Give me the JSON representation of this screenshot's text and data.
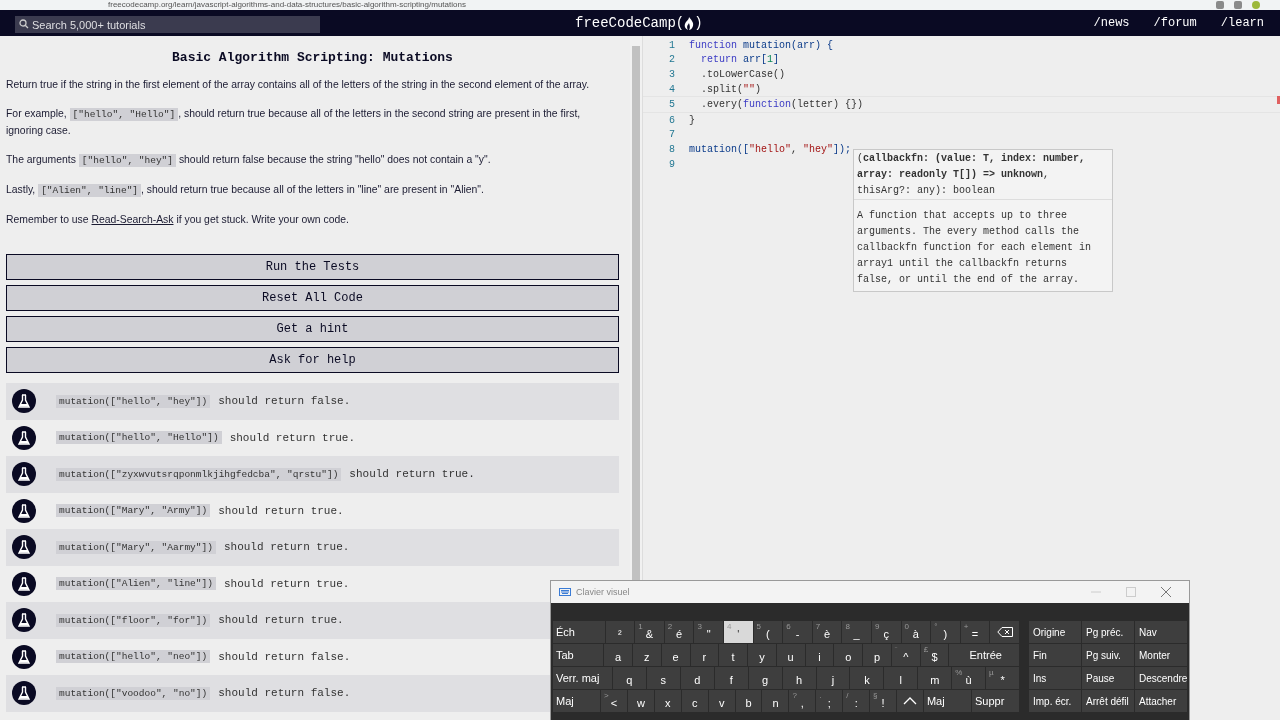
{
  "browser": {
    "url": "freecodecamp.org/learn/javascript-algorithms-and-data-structures/basic-algorithm-scripting/mutations"
  },
  "navbar": {
    "search": {
      "placeholder": "Search 5,000+ tutorials"
    },
    "logo": {
      "text": "freeCodeCamp",
      "open": "(",
      "close": ")"
    },
    "links": [
      "/news",
      "/forum",
      "/learn"
    ]
  },
  "challenge": {
    "title": "Basic Algorithm Scripting: Mutations",
    "paragraphs": [
      [
        {
          "kind": "text",
          "text": "Return true if the string in the first element of the array contains all of the letters of the string in the second element of the array."
        }
      ],
      [
        {
          "kind": "text",
          "text": "For example, "
        },
        {
          "kind": "code",
          "text": "[\"hello\", \"Hello\"]"
        },
        {
          "kind": "text",
          "text": ", should return true because all of the letters in the second string are present in the first, ignoring case."
        }
      ],
      [
        {
          "kind": "text",
          "text": "The arguments "
        },
        {
          "kind": "code",
          "text": "[\"hello\", \"hey\"]"
        },
        {
          "kind": "text",
          "text": " should return false because the string \"hello\" does not contain a \"y\"."
        }
      ],
      [
        {
          "kind": "text",
          "text": "Lastly, "
        },
        {
          "kind": "code",
          "text": "[\"Alien\", \"line\"]"
        },
        {
          "kind": "text",
          "text": ", should return true because all of the letters in \"line\" are present in \"Alien\"."
        }
      ],
      [
        {
          "kind": "text",
          "text": "Remember to use "
        },
        {
          "kind": "link",
          "text": "Read-Search-Ask"
        },
        {
          "kind": "text",
          "text": " if you get stuck. Write your own code."
        }
      ]
    ],
    "buttons": [
      "Run the Tests",
      "Reset All Code",
      "Get a hint",
      "Ask for help"
    ],
    "tests": [
      {
        "code": "mutation([\"hello\", \"hey\"])",
        "text": "should return false."
      },
      {
        "code": "mutation([\"hello\", \"Hello\"])",
        "text": "should return true."
      },
      {
        "code": "mutation([\"zyxwvutsrqponmlkjihgfedcba\", \"qrstu\"])",
        "text": "should return true."
      },
      {
        "code": "mutation([\"Mary\", \"Army\"])",
        "text": "should return true."
      },
      {
        "code": "mutation([\"Mary\", \"Aarmy\"])",
        "text": "should return true."
      },
      {
        "code": "mutation([\"Alien\", \"line\"])",
        "text": "should return true."
      },
      {
        "code": "mutation([\"floor\", \"for\"])",
        "text": "should return true."
      },
      {
        "code": "mutation([\"hello\", \"neo\"])",
        "text": "should return false."
      },
      {
        "code": "mutation([\"voodoo\", \"no\"])",
        "text": "should return false."
      }
    ]
  },
  "editor": {
    "lines": [
      {
        "number": "1",
        "indent": false,
        "tokens": [
          {
            "kind": "keyword",
            "text": "function"
          },
          {
            "kind": "name",
            "text": " mutation(arr) {"
          }
        ]
      },
      {
        "number": "2",
        "indent": true,
        "tokens": [
          {
            "kind": "keyword",
            "text": "return"
          },
          {
            "kind": "name",
            "text": " arr["
          },
          {
            "kind": "number",
            "text": "1"
          },
          {
            "kind": "name",
            "text": "]"
          }
        ]
      },
      {
        "number": "3",
        "indent": true,
        "tokens": [
          {
            "kind": "plain",
            "text": ".toLowerCase()"
          }
        ]
      },
      {
        "number": "4",
        "indent": true,
        "tokens": [
          {
            "kind": "plain",
            "text": ".split("
          },
          {
            "kind": "string",
            "text": "\"\""
          },
          {
            "kind": "plain",
            "text": ")"
          }
        ]
      },
      {
        "number": "5",
        "indent": true,
        "tokens": [
          {
            "kind": "plain",
            "text": ".every("
          },
          {
            "kind": "keyword",
            "text": "function"
          },
          {
            "kind": "plain",
            "text": "(letter) {})"
          }
        ]
      },
      {
        "number": "6",
        "indent": false,
        "tokens": [
          {
            "kind": "plain",
            "text": "}"
          }
        ]
      },
      {
        "number": "7"
      },
      {
        "number": "8",
        "indent": false,
        "tokens": [
          {
            "kind": "name",
            "text": "mutation(["
          },
          {
            "kind": "string",
            "text": "\"hello\""
          },
          {
            "kind": "plain",
            "text": ", "
          },
          {
            "kind": "string",
            "text": "\"hey\""
          },
          {
            "kind": "name",
            "text": "]);"
          }
        ]
      },
      {
        "number": "9"
      }
    ],
    "tooltip": {
      "signature": "(**callbackfn: (value: T, index: number, array: readonly T[]) => unknown**, thisArg?: any): boolean",
      "description": "A function that accepts up to three arguments. The every method calls the callbackfn function for each element in array1 until the callbackfn returns false, or until the end of the array."
    }
  },
  "keyboard": {
    "title": "Clavier visuel",
    "number_row": [
      {
        "label": "Éch",
        "pressed": false
      },
      {
        "label": "²",
        "pressed": false
      },
      {
        "alt": "1",
        "label": "&",
        "pressed": false
      },
      {
        "alt": "2",
        "label": "é",
        "pressed": false
      },
      {
        "alt": "3",
        "label": "\"",
        "pressed": false
      },
      {
        "alt": "4",
        "label": "'",
        "pressed": true
      },
      {
        "alt": "5",
        "label": "(",
        "pressed": false
      },
      {
        "alt": "6",
        "label": "-",
        "pressed": false
      },
      {
        "alt": "7",
        "label": "è",
        "pressed": false
      },
      {
        "alt": "8",
        "label": "_",
        "pressed": false
      },
      {
        "alt": "9",
        "label": "ç",
        "pressed": false
      },
      {
        "alt": "0",
        "label": "à",
        "pressed": false
      },
      {
        "alt": "°",
        "label": ")",
        "pressed": false
      },
      {
        "alt": "+",
        "label": "=",
        "pressed": false
      },
      {
        "kind": "backspace",
        "pressed": false
      }
    ],
    "top_row": [
      {
        "label": "Tab"
      },
      {
        "label": "a"
      },
      {
        "label": "z"
      },
      {
        "label": "e"
      },
      {
        "label": "r"
      },
      {
        "label": "t"
      },
      {
        "label": "y"
      },
      {
        "label": "u"
      },
      {
        "label": "i"
      },
      {
        "label": "o"
      },
      {
        "label": "p"
      },
      {
        "alt": "¨",
        "label": "^"
      },
      {
        "alt": "£",
        "label": "$"
      },
      {
        "label": "Entrée",
        "kind": "wide"
      }
    ],
    "home_row": [
      {
        "label": "Verr. maj"
      },
      {
        "label": "q"
      },
      {
        "label": "s"
      },
      {
        "label": "d"
      },
      {
        "label": "f"
      },
      {
        "label": "g"
      },
      {
        "label": "h"
      },
      {
        "label": "j"
      },
      {
        "label": "k"
      },
      {
        "label": "l"
      },
      {
        "label": "m"
      },
      {
        "alt": "%",
        "label": "ù"
      },
      {
        "alt": "µ",
        "label": "*"
      }
    ],
    "bottom_row": [
      {
        "label": "Maj"
      },
      {
        "alt": ">",
        "label": "<"
      },
      {
        "label": "w"
      },
      {
        "label": "x"
      },
      {
        "label": "c"
      },
      {
        "label": "v"
      },
      {
        "label": "b"
      },
      {
        "label": "n"
      },
      {
        "alt": "?",
        "label": ","
      },
      {
        "alt": ".",
        "label": ";"
      },
      {
        "alt": "/",
        "label": ":"
      },
      {
        "alt": "§",
        "label": "!"
      },
      {
        "kind": "up"
      },
      {
        "label": "Maj"
      },
      {
        "label": "Suppr"
      }
    ],
    "side": [
      [
        "Origine",
        "Pg préc.",
        "Nav"
      ],
      [
        "Fin",
        "Pg suiv.",
        "Monter"
      ],
      [
        "Ins",
        "Pause",
        "Descendre"
      ],
      [
        "Imp. écr.",
        "Arrêt défil",
        "Attacher"
      ]
    ]
  }
}
